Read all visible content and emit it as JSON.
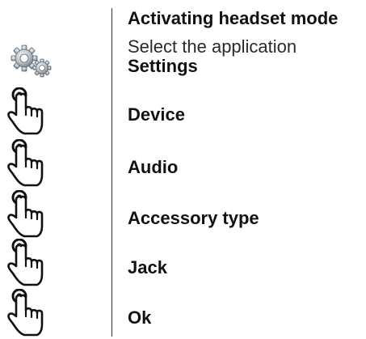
{
  "heading": "Activating headset mode",
  "instruction": {
    "text": "Select the application",
    "app_name": "Settings",
    "icon": "settings-gears-icon"
  },
  "steps": [
    {
      "label": "Device",
      "icon": "tap-hand-icon"
    },
    {
      "label": "Audio",
      "icon": "tap-hand-icon"
    },
    {
      "label": "Accessory type",
      "icon": "tap-hand-icon"
    },
    {
      "label": "Jack",
      "icon": "tap-hand-icon"
    },
    {
      "label": "Ok",
      "icon": "tap-hand-icon"
    }
  ]
}
